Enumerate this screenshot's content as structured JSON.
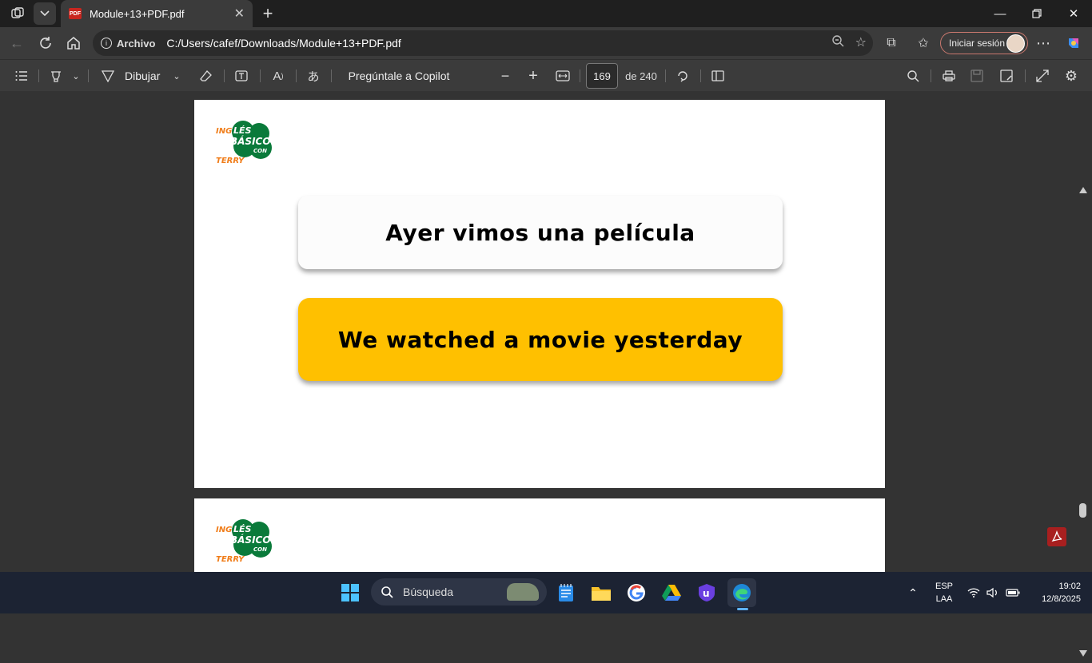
{
  "browser": {
    "tab_title": "Module+13+PDF.pdf",
    "tab_icon": "pdf-icon",
    "address_label": "Archivo",
    "url": "C:/Users/cafef/Downloads/Module+13+PDF.pdf",
    "signin_label": "Iniciar sesión"
  },
  "pdf_toolbar": {
    "draw_label": "Dibujar",
    "copilot_label": "Pregúntale a Copilot",
    "page_number": "169",
    "page_total": "de 240"
  },
  "document": {
    "logo_text": "INGLÉS BÁSICO CON TERRY",
    "card1_text": "Ayer vimos una película",
    "card2_text": "We watched a movie yesterday",
    "card2_color": "#ffc000"
  },
  "taskbar": {
    "search_placeholder": "Búsqueda",
    "lang_top": "ESP",
    "lang_bottom": "LAA",
    "time": "19:02",
    "date": "12/8/2025"
  }
}
